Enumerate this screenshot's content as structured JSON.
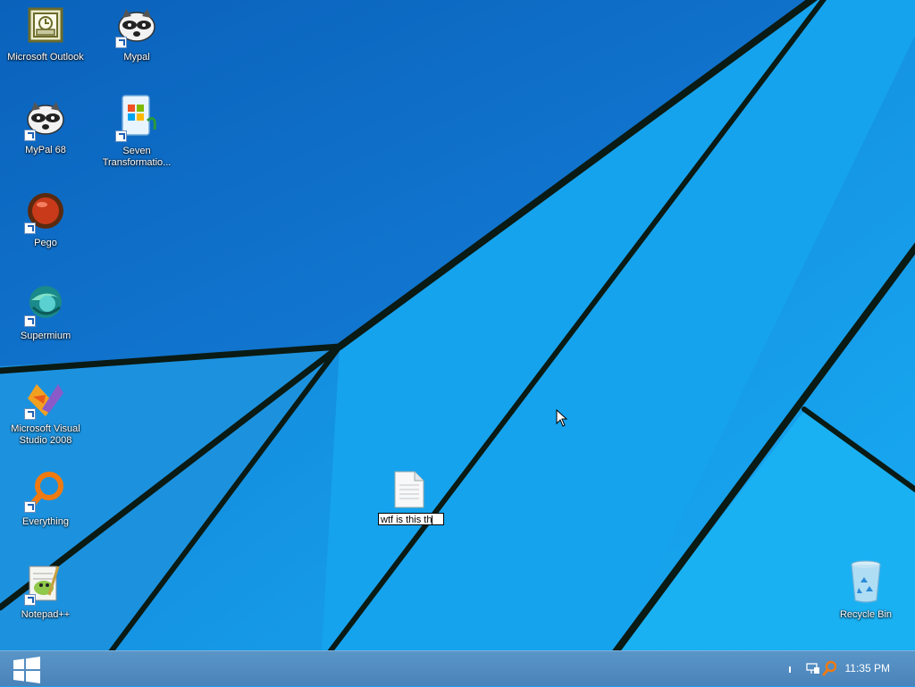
{
  "desktop": {
    "icons": [
      {
        "label": "Microsoft Outlook",
        "icon": "outlook-icon"
      },
      {
        "label": "Mypal",
        "icon": "raccoon-icon"
      },
      {
        "label": "MyPal 68",
        "icon": "raccoon-icon"
      },
      {
        "label": "Seven Transformatio...",
        "icon": "windows-logo-icon"
      },
      {
        "label": "Pego",
        "icon": "red-orb-icon"
      },
      {
        "label": "Supermium",
        "icon": "supermium-icon"
      },
      {
        "label": "Microsoft Visual Studio 2008",
        "icon": "visual-studio-icon"
      },
      {
        "label": "Everything",
        "icon": "magnifier-icon"
      },
      {
        "label": "Notepad++",
        "icon": "notepad-plus-plus-icon"
      },
      {
        "label": "Recycle Bin",
        "icon": "recycle-bin-icon"
      }
    ],
    "new_file": {
      "rename_value": "wtf is this th",
      "icon": "text-document-icon"
    }
  },
  "taskbar": {
    "start_icon": "windows-start-icon",
    "clock": "11:35 PM",
    "tray_icons": [
      "network-icon",
      "everything-tray-icon"
    ]
  },
  "colors": {
    "wallpaper": "#1aa0ee",
    "wallpaper_dark": "#0a5fb0",
    "taskbar": "#4a83b9",
    "lines": "#0a1a14"
  }
}
